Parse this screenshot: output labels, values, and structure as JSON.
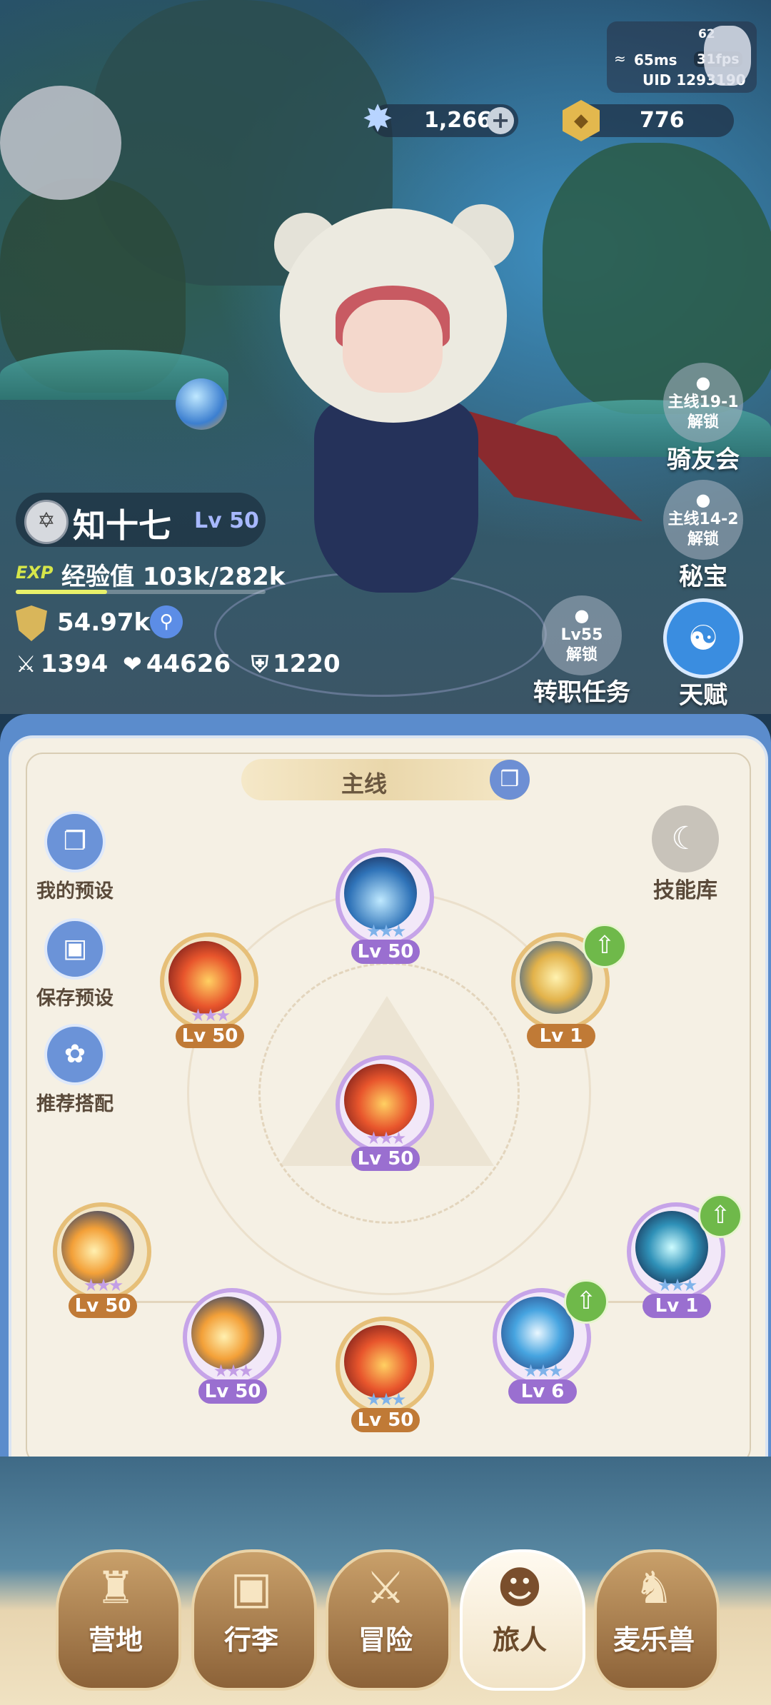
{
  "network": {
    "ping_badge": "62",
    "latency": "65ms",
    "fps": "31fps",
    "uid": "UID 1293190"
  },
  "resources": {
    "gems": "1,266",
    "gems_icon": "star-crystal-icon",
    "gems_add": "+",
    "coins": "776",
    "coins_icon": "hex-coin-icon"
  },
  "player": {
    "name": "知十七",
    "level": "Lv 50",
    "exp_tag": "EXP",
    "exp_text": "经验值 103k/282k",
    "exp_fraction": 0.365,
    "power": "54.97k",
    "attack": "1394",
    "hp": "44626",
    "defense": "1220"
  },
  "side_buttons": [
    {
      "lock_text": "主线19-1",
      "unlock_text": "解锁",
      "label": "骑友会"
    },
    {
      "lock_text": "主线14-2",
      "unlock_text": "解锁",
      "label": "秘宝"
    },
    {
      "lock_text": "Lv55",
      "unlock_text": "解锁",
      "label": "转职任务"
    },
    {
      "label": "天赋"
    }
  ],
  "skill_panel": {
    "tab_label": "主线",
    "actions": [
      {
        "label": "我的预设",
        "icon": "card-icon"
      },
      {
        "label": "保存预设",
        "icon": "save-icon"
      },
      {
        "label": "推荐搭配",
        "icon": "combo-icon"
      }
    ],
    "skill_library": "技能库",
    "skills": [
      {
        "id": "top",
        "level": "Lv 50",
        "style": "purple",
        "stars": "★★★",
        "upgrade": false
      },
      {
        "id": "upper-left",
        "level": "Lv 50",
        "style": "orange",
        "stars": "★★★",
        "upgrade": false
      },
      {
        "id": "upper-right",
        "level": "Lv 1",
        "style": "orange",
        "stars": "",
        "upgrade": true
      },
      {
        "id": "center",
        "level": "Lv 50",
        "style": "purple",
        "stars": "★★★",
        "upgrade": false
      },
      {
        "id": "lower-left-1",
        "level": "Lv 50",
        "style": "orange",
        "stars": "★★★",
        "upgrade": false
      },
      {
        "id": "lower-left-2",
        "level": "Lv 50",
        "style": "purple",
        "stars": "★★★",
        "upgrade": false
      },
      {
        "id": "bottom",
        "level": "Lv 50",
        "style": "orange",
        "stars": "★★★",
        "upgrade": false
      },
      {
        "id": "lower-right-2",
        "level": "Lv 6",
        "style": "purple",
        "stars": "★★★",
        "upgrade": true
      },
      {
        "id": "lower-right-1",
        "level": "Lv 1",
        "style": "purple",
        "stars": "★★★",
        "upgrade": true
      }
    ]
  },
  "nav": [
    {
      "label": "营地",
      "icon": "castle-icon"
    },
    {
      "label": "行李",
      "icon": "backpack-icon"
    },
    {
      "label": "冒险",
      "icon": "crossed-swords-icon"
    },
    {
      "label": "旅人",
      "icon": "traveler-icon",
      "active": true
    },
    {
      "label": "麦乐兽",
      "icon": "beast-icon"
    }
  ]
}
